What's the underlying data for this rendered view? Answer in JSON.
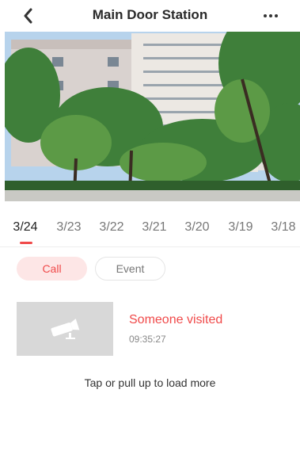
{
  "header": {
    "title": "Main Door Station",
    "back_icon": "chevron-left-icon",
    "more_icon": "more-dots-icon"
  },
  "date_tabs": {
    "items": [
      "3/24",
      "3/23",
      "3/22",
      "3/21",
      "3/20",
      "3/19",
      "3/18"
    ],
    "selected": "3/24"
  },
  "filters": {
    "call_label": "Call",
    "event_label": "Event",
    "selected": "Call"
  },
  "records": [
    {
      "title": "Someone visited",
      "time": "09:35:27",
      "thumbnail_icon": "camera-icon"
    }
  ],
  "load_more_label": "Tap or pull up to load more",
  "colors": {
    "accent": "#f04a4a",
    "accent_light": "#fde6e6",
    "thumbnail_bg": "#d8d8d8"
  }
}
